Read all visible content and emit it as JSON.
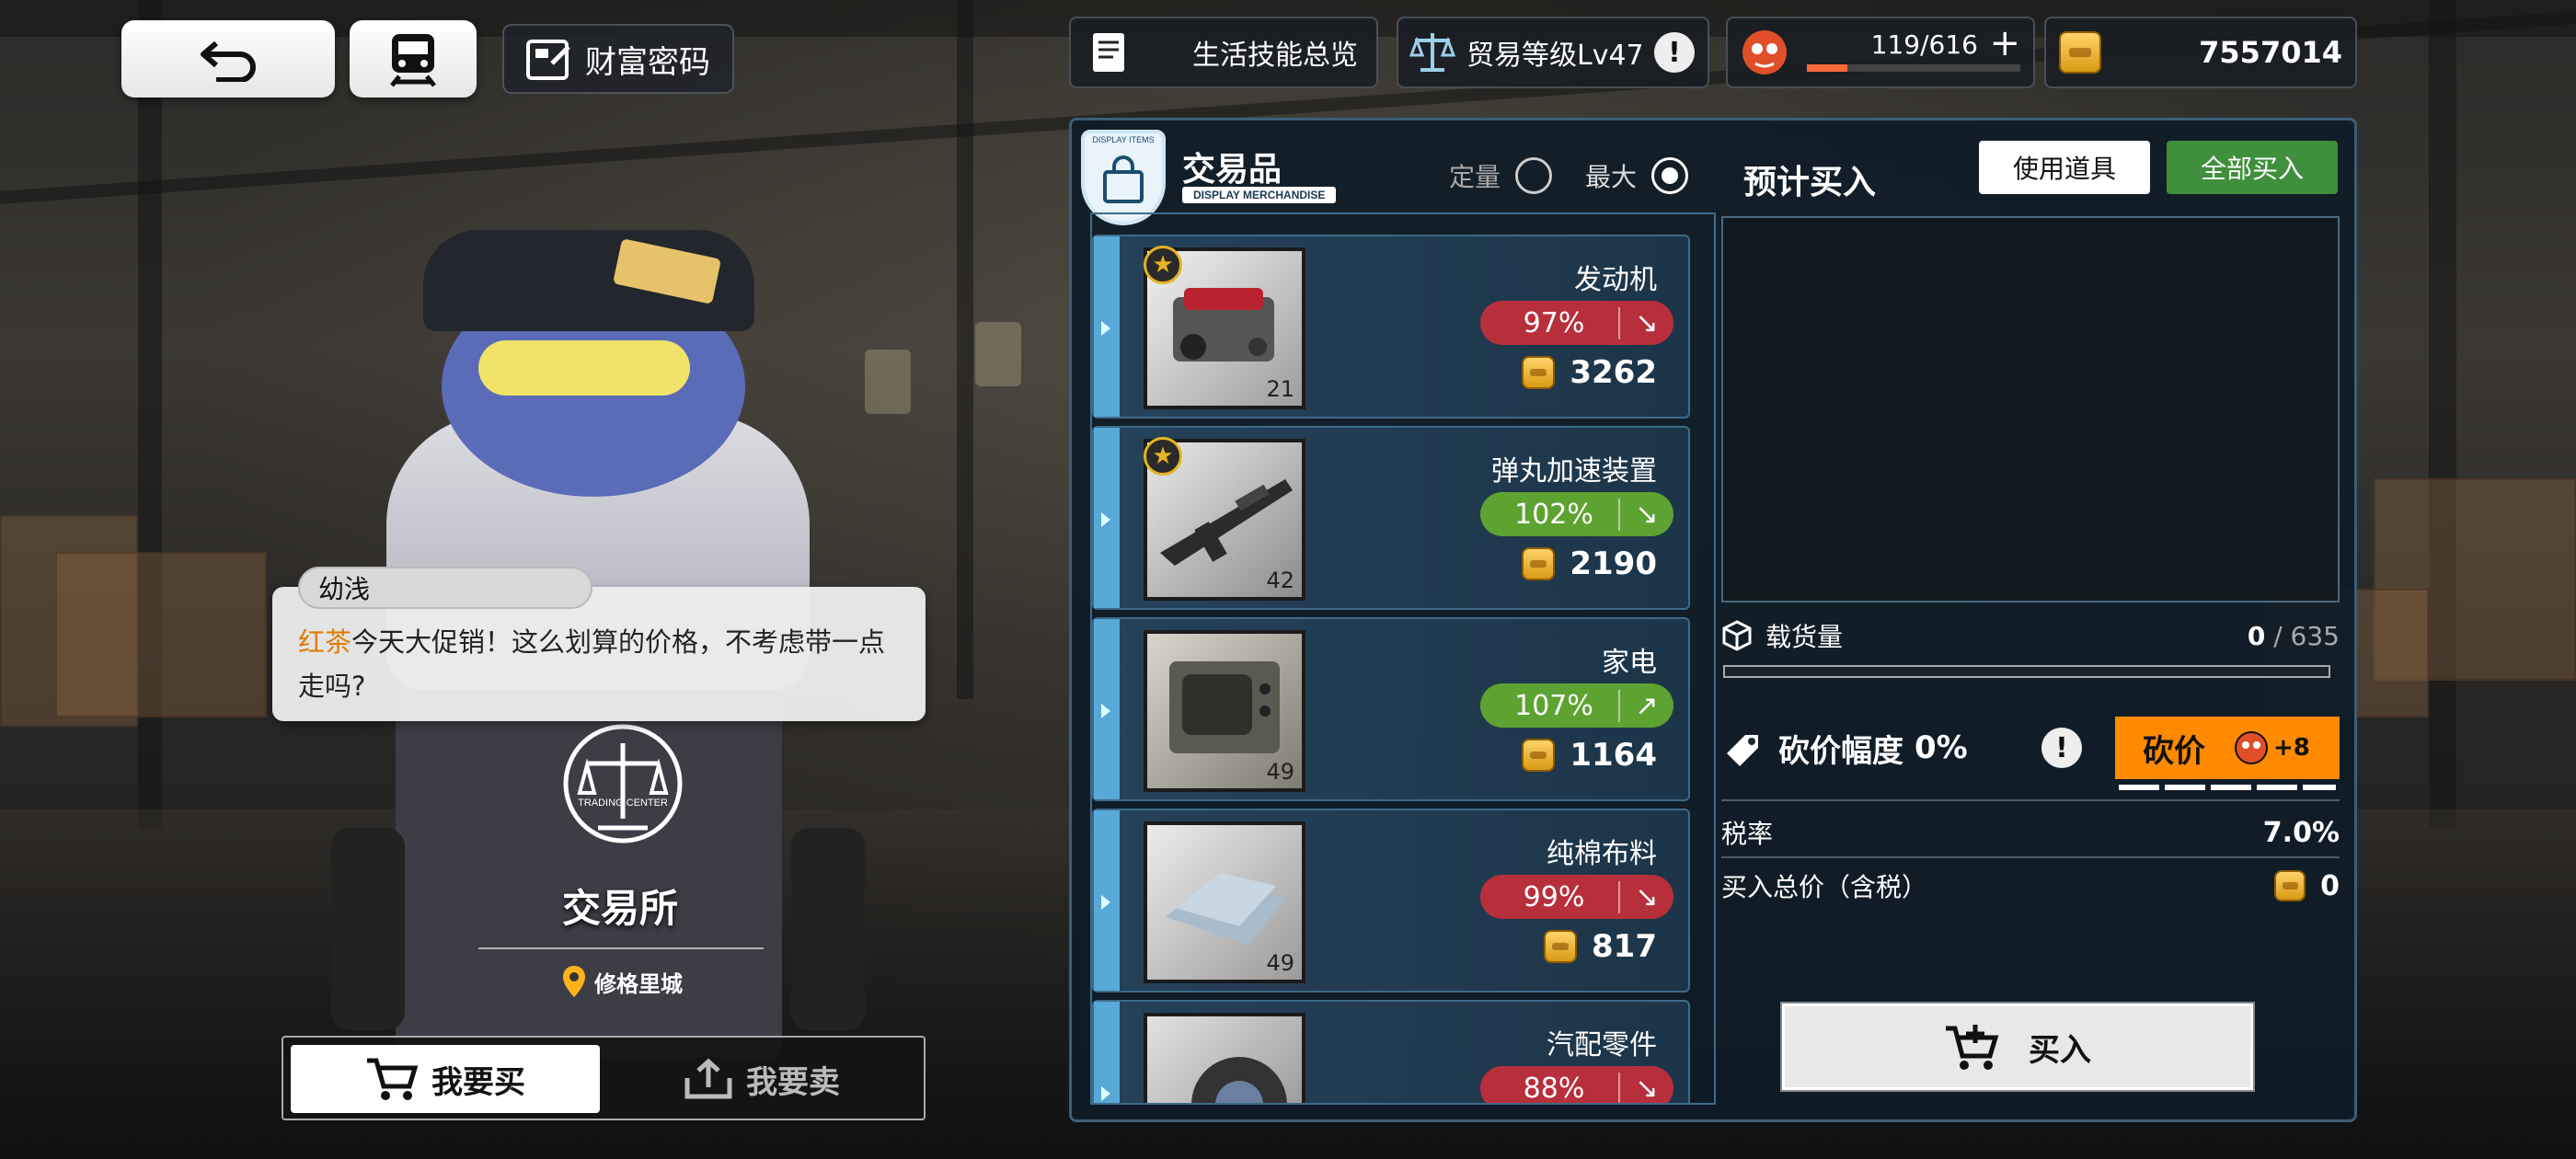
{
  "top_left": {
    "wealth_label": "财富密码"
  },
  "stats": {
    "life_skills_label": "生活技能总览",
    "trade_level_label": "贸易等级Lv47",
    "stamina_value": "119/616",
    "stamina_plus": "+",
    "coins": "7557014",
    "info_mark": "!"
  },
  "npc": {
    "speaker": "幼浅",
    "dialog_name": "红茶",
    "dialog_text": "今天大促销！这么划算的价格，不考虑带一点走吗?",
    "station_badge_text": "TRADING CENTER",
    "station_title": "交易所",
    "location": "修格里城"
  },
  "mode_tabs": {
    "buy": "我要买",
    "sell": "我要卖"
  },
  "panel": {
    "badge_top": "DISPLAY ITEMS",
    "title": "交易品",
    "subtitle": "DISPLAY MERCHANDISE",
    "option_fixed": "定量",
    "option_max": "最大",
    "preview_title": "预计买入",
    "use_item_button": "使用道具",
    "buy_all_button": "全部买入"
  },
  "goods": [
    {
      "name": "发动机",
      "percent": "97%",
      "trend": "down",
      "trend_icon": "↘",
      "price": "3262",
      "stock": "21",
      "starred": true
    },
    {
      "name": "弹丸加速装置",
      "percent": "102%",
      "trend": "down",
      "trend_icon": "↘",
      "price": "2190",
      "stock": "42",
      "starred": true
    },
    {
      "name": "家电",
      "percent": "107%",
      "trend": "up",
      "trend_icon": "↗",
      "price": "1164",
      "stock": "49",
      "starred": false
    },
    {
      "name": "纯棉布料",
      "percent": "99%",
      "trend": "down",
      "trend_icon": "↘",
      "price": "817",
      "stock": "49",
      "starred": false
    },
    {
      "name": "汽配零件",
      "percent": "88%",
      "trend": "down",
      "trend_icon": "↘",
      "price": "",
      "stock": "",
      "starred": false
    }
  ],
  "cargo": {
    "label": "载货量",
    "current": "0",
    "separator": " / ",
    "capacity": "635"
  },
  "bargain": {
    "label": "砍价幅度",
    "value": "0%",
    "info_mark": "!",
    "button": "砍价",
    "button_bonus": "+8"
  },
  "tax": {
    "label": "税率",
    "value": "7.0%"
  },
  "total": {
    "label": "买入总价（含税）",
    "value": "0"
  },
  "buy_button": "买入",
  "colors": {
    "accent_orange": "#ff8a00",
    "buy_all_green": "#3f8f3c",
    "trend_red": "#b82f3c",
    "trend_green": "#5ea232"
  }
}
